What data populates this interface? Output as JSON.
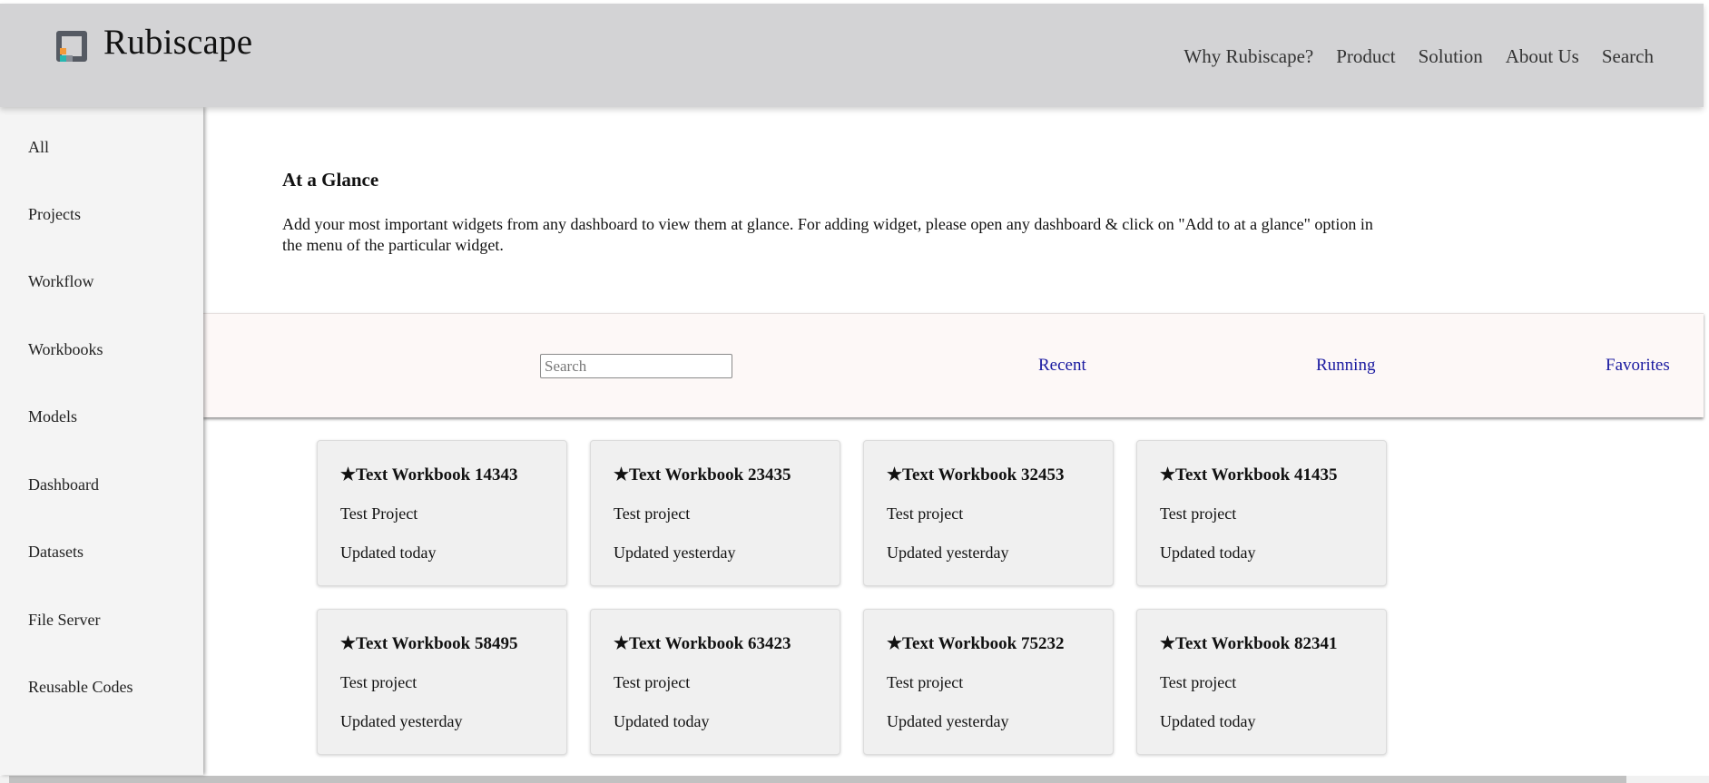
{
  "header": {
    "brand": "Rubiscape",
    "nav": [
      "Why Rubiscape?",
      "Product",
      "Solution",
      "About Us",
      "Search"
    ]
  },
  "sidebar": {
    "items": [
      "All",
      "Projects",
      "Workflow",
      "Workbooks",
      "Models",
      "Dashboard",
      "Datasets",
      "File Server",
      "Reusable Codes"
    ]
  },
  "glance": {
    "title": "At a Glance",
    "description": "Add your most important widgets from any dashboard to view them at glance. For adding widget, please open any dashboard & click on \"Add to at a glance\" option in the menu of the particular widget."
  },
  "filter": {
    "search_placeholder": "Search",
    "search_value": "",
    "recent": "Recent",
    "running": "Running",
    "favorites": "Favorites"
  },
  "cards": [
    {
      "title": "★Text Workbook 14343",
      "project": "Test Project",
      "updated": "Updated today"
    },
    {
      "title": "★Text Workbook 23435",
      "project": "Test project",
      "updated": "Updated yesterday"
    },
    {
      "title": "★Text Workbook 32453",
      "project": "Test project",
      "updated": "Updated yesterday"
    },
    {
      "title": "★Text Workbook 41435",
      "project": "Test project",
      "updated": "Updated today"
    },
    {
      "title": "★Text Workbook 58495",
      "project": "Test project",
      "updated": "Updated yesterday"
    },
    {
      "title": "★Text Workbook 63423",
      "project": "Test project",
      "updated": "Updated today"
    },
    {
      "title": "★Text Workbook 75232",
      "project": "Test project",
      "updated": "Updated yesterday"
    },
    {
      "title": "★Text Workbook 82341",
      "project": "Test project",
      "updated": "Updated today"
    }
  ],
  "colors": {
    "header_bg": "#d3d3d5",
    "sidebar_bg": "#f4f4f4",
    "filter_bg": "#fdf8f7",
    "link": "#1a1aa0",
    "card_bg": "#f0f0f0"
  }
}
